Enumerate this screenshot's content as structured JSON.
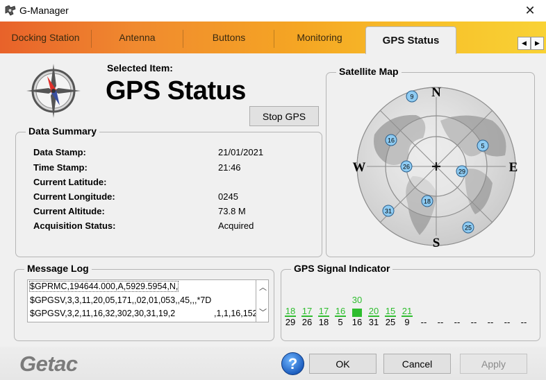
{
  "window": {
    "title": "G-Manager",
    "close_glyph": "✕",
    "app_icon": "getac-wrench-icon"
  },
  "tabs": [
    {
      "label": "Docking Station"
    },
    {
      "label": "Antenna"
    },
    {
      "label": "Buttons"
    },
    {
      "label": "Monitoring"
    },
    {
      "label": "GPS Status",
      "active": true
    }
  ],
  "tab_scroll": {
    "left": "◀",
    "right": "▶"
  },
  "header": {
    "selected_label": "Selected Item:",
    "selected_value": "GPS Status",
    "stop_gps_label": "Stop GPS",
    "icon": "compass-icon"
  },
  "data_summary": {
    "title": "Data Summary",
    "rows": [
      {
        "label": "Data Stamp:",
        "value": "21/01/2021"
      },
      {
        "label": "Time Stamp:",
        "value": "21:46"
      },
      {
        "label": "Current Latitude:",
        "value": ""
      },
      {
        "label": "Current Longitude:",
        "value": "0245"
      },
      {
        "label": "Current Altitude:",
        "value": "73.8 M"
      },
      {
        "label": "Acquisition Status:",
        "value": "Acquired"
      }
    ]
  },
  "satellite_map": {
    "title": "Satellite Map",
    "directions": {
      "n": "N",
      "s": "S",
      "e": "E",
      "w": "W"
    },
    "satellites": [
      "9",
      "16",
      "5",
      "26",
      "29",
      "18",
      "31",
      "25"
    ]
  },
  "message_log": {
    "title": "Message Log",
    "lines": [
      "$GPRMC,194644.000,A,5929.5954,N,",
      "$GPGSV,3,3,11,20,05,171,,02,01,053,,45,,,*7D",
      "$GPGSV,3,2,11,16,32,302,30,31,19,2",
      ",1,1,16,152"
    ],
    "scroll_up": "︿",
    "scroll_down": "﹀"
  },
  "signal_indicator": {
    "title": "GPS Signal Indicator",
    "signals": [
      "18",
      "17",
      "17",
      "16",
      "30",
      "20",
      "15",
      "21",
      "",
      "",
      "",
      "",
      "",
      "",
      ""
    ],
    "prns": [
      "29",
      "26",
      "18",
      "5",
      "16",
      "31",
      "25",
      "9",
      "--",
      "--",
      "--",
      "--",
      "--",
      "--",
      "--"
    ],
    "colors": {
      "green": "#2ebd2e"
    }
  },
  "footer": {
    "logo": "Getac",
    "help_glyph": "?",
    "ok_label": "OK",
    "cancel_label": "Cancel",
    "apply_label": "Apply"
  },
  "colors": {
    "tab_gradient_start": "#e8622a",
    "tab_gradient_end": "#f9d235",
    "satellite_fill": "#8ecbf2",
    "signal_green": "#2ebd2e"
  }
}
